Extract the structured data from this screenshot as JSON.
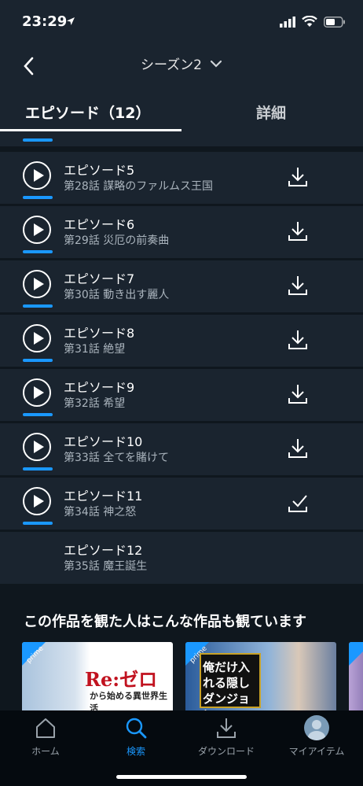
{
  "status_bar": {
    "time": "23:29"
  },
  "header": {
    "season_label": "シーズン2",
    "tabs": [
      {
        "label": "エピソード（12）",
        "active": true
      },
      {
        "label": "詳細",
        "active": false
      }
    ]
  },
  "episodes": [
    {
      "title": "エピソード5",
      "subtitle": "第28話 謀略のファルムス王国",
      "action": "download-icon",
      "progress_visible": true
    },
    {
      "title": "エピソード6",
      "subtitle": "第29話 災厄の前奏曲",
      "action": "download-icon",
      "progress_visible": true
    },
    {
      "title": "エピソード7",
      "subtitle": "第30話 動き出す麗人",
      "action": "download-icon",
      "progress_visible": true
    },
    {
      "title": "エピソード8",
      "subtitle": "第31話 絶望",
      "action": "download-icon",
      "progress_visible": true
    },
    {
      "title": "エピソード9",
      "subtitle": "第32話 希望",
      "action": "download-icon",
      "progress_visible": true
    },
    {
      "title": "エピソード10",
      "subtitle": "第33話 全てを賭けて",
      "action": "download-icon",
      "progress_visible": true
    },
    {
      "title": "エピソード11",
      "subtitle": "第34話 神之怒",
      "action": "checkmark-icon",
      "progress_visible": true
    },
    {
      "title": "エピソード12",
      "subtitle": "第35話 魔王誕生",
      "action": "none",
      "progress_visible": false
    }
  ],
  "recommendations": {
    "title": "この作品を観た人はこんな作品も観ています",
    "prime_badge": "prime",
    "cards": [
      {
        "logo": "Re:ゼロ",
        "subtitle": "から始める異世界生活"
      },
      {
        "logo": "俺だけ入れる隠しダンジョン"
      }
    ]
  },
  "tabbar": {
    "items": [
      {
        "label": "ホーム",
        "icon": "home-icon",
        "active": false
      },
      {
        "label": "検索",
        "icon": "search-icon",
        "active": true
      },
      {
        "label": "ダウンロード",
        "icon": "download-icon",
        "active": false
      },
      {
        "label": "マイアイテム",
        "icon": "avatar",
        "active": false
      }
    ]
  },
  "colors": {
    "accent": "#1a98ff",
    "background": "#0f171e",
    "row": "#1a242f"
  }
}
